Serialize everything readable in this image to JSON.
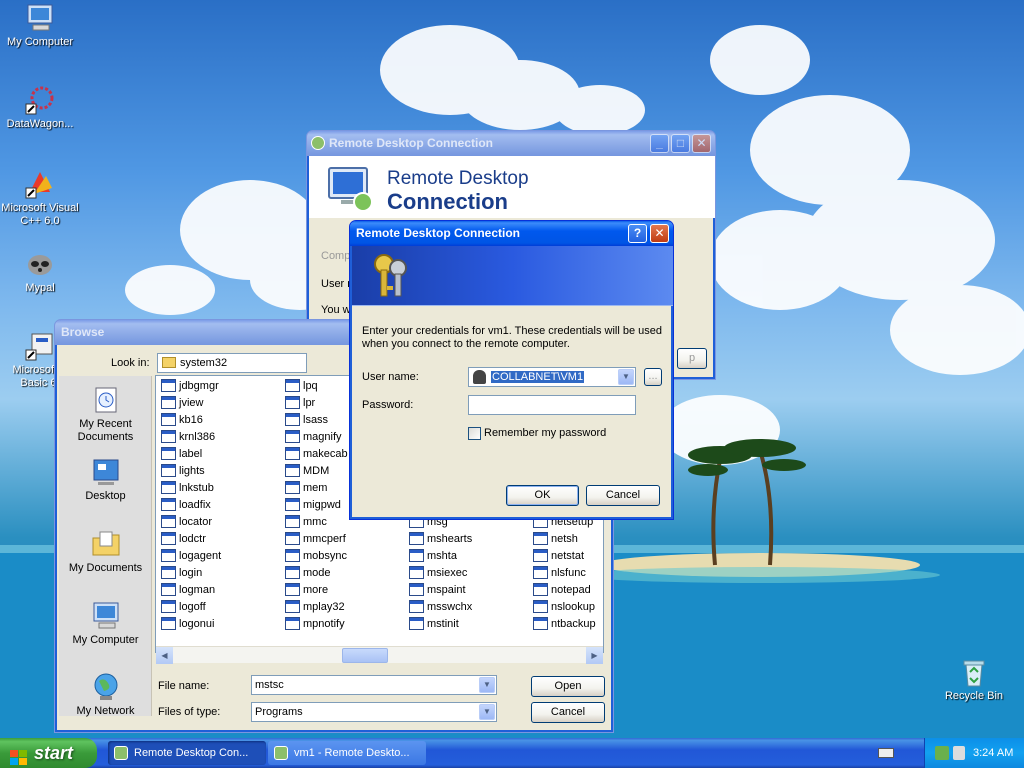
{
  "desktop": {
    "icons": [
      {
        "label": "My Computer"
      },
      {
        "label": "DataWagon..."
      },
      {
        "label": "Microsoft Visual\nC++ 6.0"
      },
      {
        "label": "Mypal"
      },
      {
        "label": "Microsoft V\nBasic 6."
      },
      {
        "label": "Recycle Bin"
      }
    ]
  },
  "rdc_main": {
    "title": "Remote Desktop Connection",
    "banner_line1": "Remote Desktop",
    "banner_line2": "Connection",
    "partial_1": "Comp",
    "partial_2": "User n",
    "partial_3": "You w",
    "partial_4": "p"
  },
  "creds": {
    "title": "Remote Desktop Connection",
    "message": "Enter your credentials for vm1. These credentials will be used when you connect to the remote computer.",
    "username_label": "User name:",
    "username_value": "COLLABNET\\VM1",
    "password_label": "Password:",
    "password_value": "",
    "remember_label": "Remember my password",
    "ok_label": "OK",
    "cancel_label": "Cancel",
    "browse_label": "..."
  },
  "browse": {
    "title": "Browse",
    "lookin_label": "Look in:",
    "lookin_value": "system32",
    "places": [
      "My Recent\nDocuments",
      "Desktop",
      "My Documents",
      "My Computer",
      "My Network"
    ],
    "files": [
      [
        "jdbgmgr",
        "jview",
        "kb16",
        "krnl386",
        "label",
        "lights",
        "lnkstub",
        "loadfix",
        "locator",
        "lodctr",
        "logagent",
        "login",
        "logman",
        "logoff",
        "logonui"
      ],
      [
        "lpq",
        "lpr",
        "lsass",
        "magnify",
        "makecab",
        "MDM",
        "mem",
        "migpwd",
        "mmc",
        "mmcperf",
        "mobsync",
        "mode",
        "more",
        "mplay32",
        "mpnotify"
      ],
      [
        "msg",
        "mshearts",
        "mshta",
        "msiexec",
        "mspaint",
        "msswchx",
        "mstinit"
      ],
      [
        "netsetup",
        "netsh",
        "netstat",
        "nlsfunc",
        "notepad",
        "nslookup",
        "ntbackup"
      ]
    ],
    "filename_label": "File name:",
    "filename_value": "mstsc",
    "filetype_label": "Files of type:",
    "filetype_value": "Programs",
    "open_label": "Open",
    "cancel_label": "Cancel"
  },
  "taskbar": {
    "start_label": "start",
    "tasks": [
      "Remote Desktop Con...",
      "vm1 - Remote Deskto..."
    ],
    "clock": "3:24 AM"
  }
}
